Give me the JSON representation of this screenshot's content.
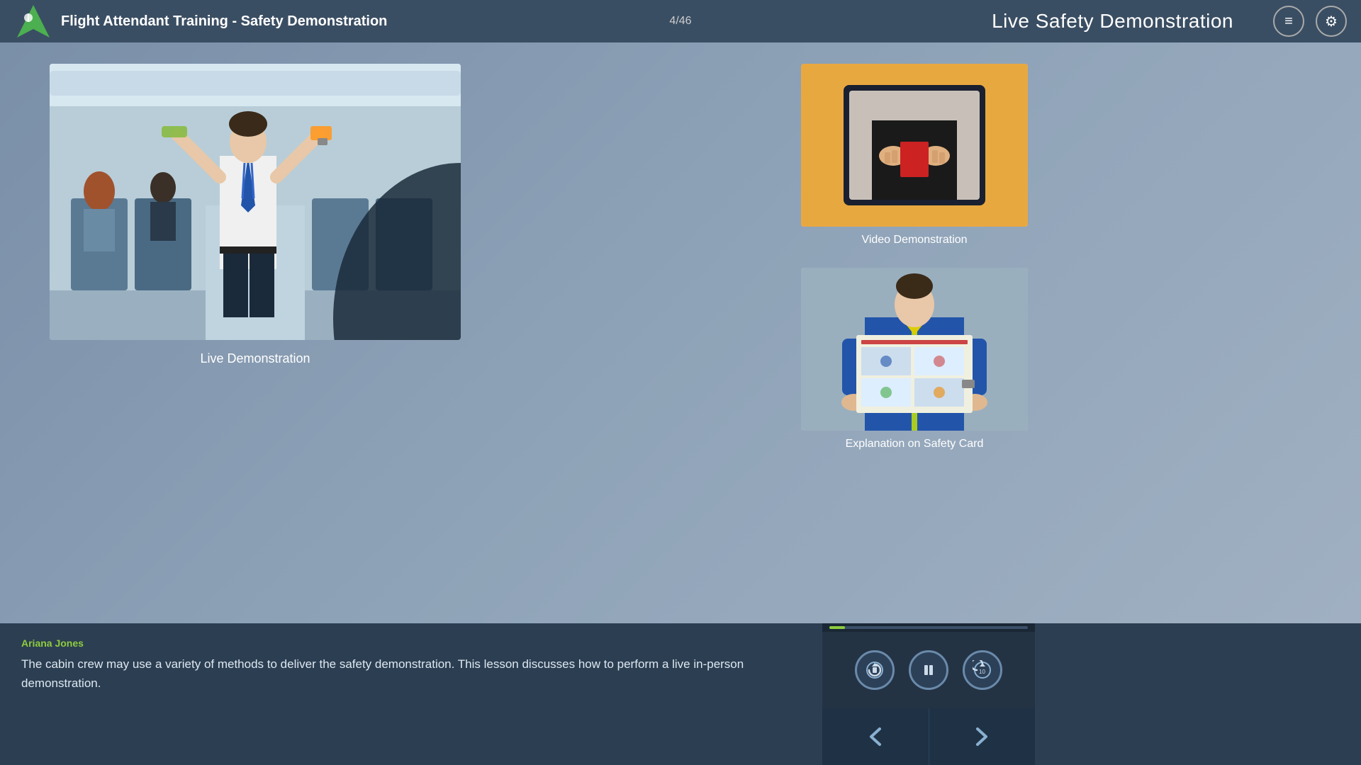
{
  "header": {
    "title": "Flight Attendant Training - Safety Demonstration",
    "slide_counter": "4/46",
    "lesson_title": "Live Safety Demonstration",
    "menu_icon": "≡",
    "settings_icon": "⚙"
  },
  "main": {
    "left": {
      "image_label": "Live Demonstration",
      "image_alt": "Flight attendant demonstrating safety equipment in aircraft cabin"
    },
    "right": {
      "top_label": "Video Demonstration",
      "top_alt": "Video demonstration of safety card",
      "bottom_label": "Explanation on Safety Card",
      "bottom_alt": "Flight attendant holding safety card"
    }
  },
  "bottom": {
    "narrator": "Ariana Jones",
    "transcript": "The cabin crew may use a variety of methods to deliver the safety demonstration. This lesson discusses how to perform a live in-person demonstration.",
    "progress_pct": 8,
    "controls": {
      "replay_label": "⟳",
      "pause_label": "⏸",
      "rewind_label": "↺10",
      "prev_label": "❮",
      "next_label": "❯"
    }
  },
  "logo": {
    "alt": "Airline Logo"
  }
}
